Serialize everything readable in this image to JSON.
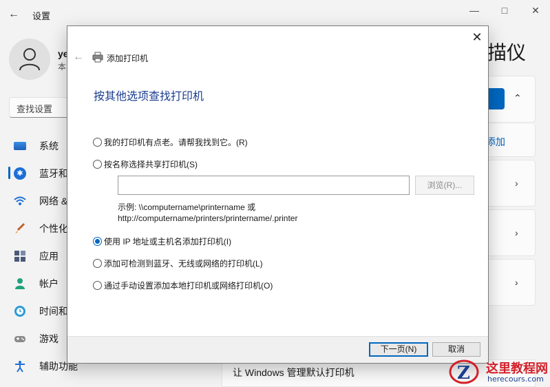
{
  "settings": {
    "title": "设置",
    "user": {
      "name": "ye",
      "sub": "本"
    },
    "search_placeholder": "查找设置",
    "nav": [
      {
        "label": "系统",
        "icon": "monitor-icon"
      },
      {
        "label": "蓝牙和",
        "icon": "bluetooth-icon"
      },
      {
        "label": "网络 &",
        "icon": "wifi-icon"
      },
      {
        "label": "个性化",
        "icon": "brush-icon"
      },
      {
        "label": "应用",
        "icon": "apps-icon"
      },
      {
        "label": "帐户",
        "icon": "person-icon"
      },
      {
        "label": "时间和",
        "icon": "clock-globe-icon"
      },
      {
        "label": "游戏",
        "icon": "gamepad-icon"
      },
      {
        "label": "辅助功能",
        "icon": "accessibility-icon"
      }
    ],
    "right_title_fragment": "描仪",
    "add_link_fragment": "添加",
    "bottom_text": "让 Windows 管理默认打印机"
  },
  "dialog": {
    "title": "添加打印机",
    "heading": "按其他选项查找打印机",
    "options": [
      {
        "label": "我的打印机有点老。请帮我找到它。(R)",
        "checked": false
      },
      {
        "label": "按名称选择共享打印机(S)",
        "checked": false
      },
      {
        "label": "使用 IP 地址或主机名添加打印机(I)",
        "checked": true
      },
      {
        "label": "添加可检测到蓝牙、无线或网络的打印机(L)",
        "checked": false
      },
      {
        "label": "通过手动设置添加本地打印机或网络打印机(O)",
        "checked": false
      }
    ],
    "share_input_value": "",
    "browse_label": "浏览(R)...",
    "example_line1": "示例: \\\\computername\\printername 或",
    "example_line2": "http://computername/printers/printername/.printer",
    "next_label": "下一页(N)",
    "cancel_label": "取消"
  },
  "watermark": {
    "name": "这里教程网",
    "url": "herecours.com"
  },
  "colors": {
    "accent": "#0067c0",
    "heading": "#1a3d8f",
    "watermark_red": "#d3202a"
  }
}
